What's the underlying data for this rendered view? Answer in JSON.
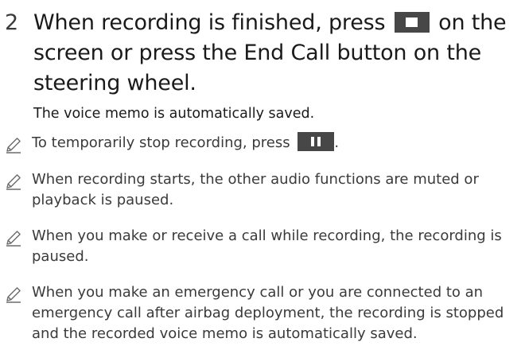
{
  "step": {
    "number": "2",
    "text_before_icon": "When recording is finished, press",
    "text_after_icon": "on the screen or press the End Call button on the steering wheel.",
    "icon": "stop-square-icon"
  },
  "result": "The voice memo is automatically saved.",
  "notes": [
    {
      "text_before_icon": "To temporarily stop recording, press",
      "text_after_icon": ".",
      "icon": "pause-icon"
    },
    {
      "text": "When recording starts, the other audio functions are muted or playback is paused."
    },
    {
      "text": "When you make or receive a call while recording, the recording is paused."
    },
    {
      "text": "When you make an emergency call or you are connected to an emergency call after airbag deployment, the recording is stopped and the recorded voice memo is automatically saved."
    }
  ],
  "colors": {
    "text": "#1a1a1a",
    "note_text": "#3a3a3a",
    "button_bg": "#474747",
    "icon_stroke": "#6b6b6b"
  }
}
